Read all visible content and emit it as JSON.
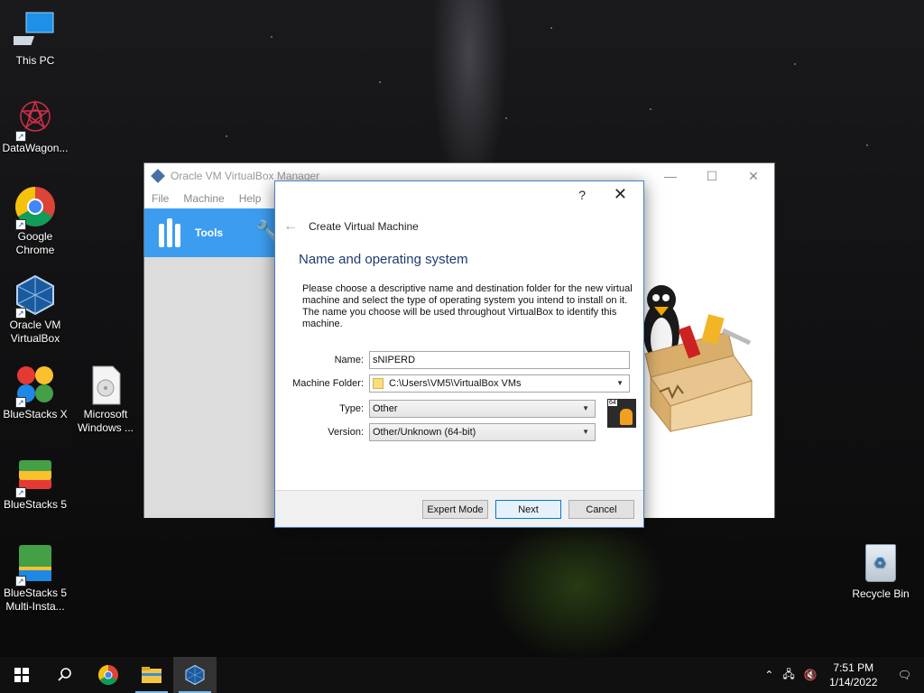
{
  "desktop_icons": [
    {
      "label": "This PC",
      "icon": "computer-icon"
    },
    {
      "label": "DataWagon...",
      "icon": "datawagon-icon"
    },
    {
      "label": "Google Chrome",
      "icon": "chrome-icon"
    },
    {
      "label": "Oracle VM VirtualBox",
      "icon": "virtualbox-icon"
    },
    {
      "label": "BlueStacks X",
      "icon": "bluestacks-x-icon"
    },
    {
      "label": "Microsoft Windows ...",
      "icon": "disc-file-icon"
    },
    {
      "label": "BlueStacks 5",
      "icon": "bluestacks-icon"
    },
    {
      "label": "BlueStacks 5 Multi-Insta...",
      "icon": "bluestacks-multi-icon"
    },
    {
      "label": "Recycle Bin",
      "icon": "recycle-bin-icon"
    }
  ],
  "manager": {
    "title": "Oracle VM VirtualBox Manager",
    "menu": [
      "File",
      "Machine",
      "Help"
    ],
    "tools_label": "Tools",
    "controls": {
      "minimize": "—",
      "maximize": "☐",
      "close": "✕"
    }
  },
  "dialog": {
    "help": "?",
    "close": "✕",
    "back": "←",
    "title": "Create Virtual Machine",
    "subtitle": "Name and operating system",
    "description": "Please choose a descriptive name and destination folder for the new virtual machine and select the type of operating system you intend to install on it. The name you choose will be used throughout VirtualBox to identify this machine.",
    "fields": {
      "name_label": "Name:",
      "name_value": "sNIPERD",
      "folder_label": "Machine Folder:",
      "folder_value": "C:\\Users\\VM5\\VirtualBox VMs",
      "type_label": "Type:",
      "type_value": "Other",
      "version_label": "Version:",
      "version_value": "Other/Unknown (64-bit)"
    },
    "os_badge": "64",
    "buttons": {
      "expert": "Expert Mode",
      "next": "Next",
      "cancel": "Cancel"
    }
  },
  "taskbar": {
    "apps": [
      "start-icon",
      "search-icon",
      "chrome-icon",
      "file-explorer-icon",
      "virtualbox-icon"
    ],
    "time": "7:51 PM",
    "date": "1/14/2022"
  },
  "colors": {
    "accent": "#3c9df0",
    "dialog_border": "#4a7fc8",
    "title_text": "#1e3c6e"
  }
}
